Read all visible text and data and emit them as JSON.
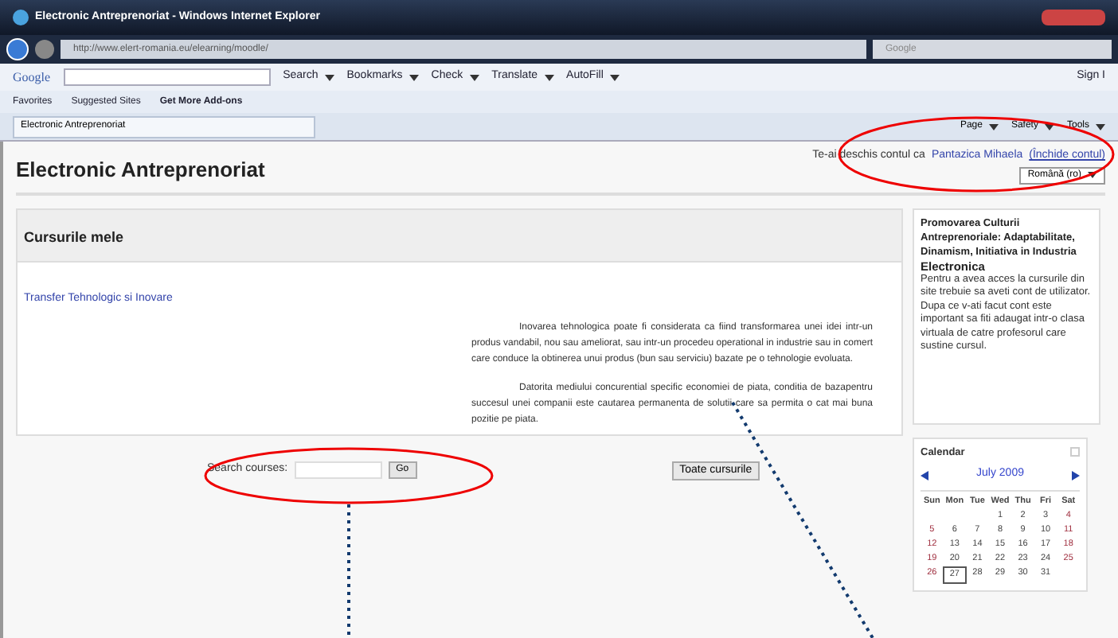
{
  "window": {
    "title": "Electronic Antreprenoriat - Windows Internet Explorer"
  },
  "address_bar": {
    "url": "http://www.elert-romania.eu/elearning/moodle/",
    "search_placeholder": "Google"
  },
  "google_toolbar": {
    "logo": "Google",
    "items": [
      "Search",
      "Bookmarks",
      "Check",
      "Translate",
      "AutoFill"
    ],
    "sign_in": "Sign I"
  },
  "favorites_bar": {
    "items": [
      "Favorites",
      "Suggested Sites",
      "Get More Add-ons"
    ]
  },
  "tab": {
    "title": "Electronic Antreprenoriat"
  },
  "command_bar": {
    "items": [
      "Page",
      "Safety",
      "Tools"
    ]
  },
  "page": {
    "title": "Electronic Antreprenoriat",
    "login_prefix": "Te-ai deschis contul ca",
    "user": "Pantazica Mihaela",
    "logout": "(Închide contul)",
    "language": "Română (ro)"
  },
  "courses": {
    "title": "Cursurile mele",
    "link": "Transfer Tehnologic si Inovare",
    "paragraphs": [
      "Inovarea tehnologica poate fi considerata ca fiind transformarea unei idei intr-un produs vandabil, nou sau ameliorat, sau intr-un procedeu operational in industrie sau in comert care conduce la obtinerea unui produs (bun sau serviciu) bazate pe o tehnologie evoluata.",
      "Datorita mediului concurential specific economiei de piata, conditia de bazapentru succesul unei companii este cautarea permanenta de solutii care sa permita o cat mai buna pozitie pe piata."
    ]
  },
  "search": {
    "label": "Search courses:",
    "button": "Go"
  },
  "all_courses_button": "Toate cursurile",
  "side_block": {
    "title": "Promovarea Culturii Antreprenoriale: Adaptabilitate, Dinamism, Initiativa in Industria",
    "subtitle": "Electronica",
    "text": "Pentru a avea acces la cursurile din site trebuie sa aveti cont de utilizator. Dupa ce v-ati facut cont este important sa fiti adaugat intr-o clasa virtuala de catre profesorul care sustine cursul."
  },
  "calendar": {
    "title": "Calendar",
    "month": "July 2009",
    "weekdays": [
      "Sun",
      "Mon",
      "Tue",
      "Wed",
      "Thu",
      "Fri",
      "Sat"
    ],
    "weeks": [
      [
        {
          "d": "1",
          "today": false
        },
        {
          "d": "2",
          "today": false
        },
        {
          "d": "3",
          "today": false
        },
        {
          "d": "4",
          "today": false
        }
      ],
      [
        {
          "d": "5",
          "today": false
        },
        {
          "d": "6",
          "today": false
        },
        {
          "d": "7",
          "today": false
        },
        {
          "d": "8",
          "today": false
        },
        {
          "d": "9",
          "today": false
        },
        {
          "d": "10",
          "today": false
        },
        {
          "d": "11",
          "today": false
        }
      ],
      [
        {
          "d": "12",
          "today": false
        },
        {
          "d": "13",
          "today": false
        },
        {
          "d": "14",
          "today": false
        },
        {
          "d": "15",
          "today": false
        },
        {
          "d": "16",
          "today": false
        },
        {
          "d": "17",
          "today": false
        },
        {
          "d": "18",
          "today": false
        }
      ],
      [
        {
          "d": "19",
          "today": false
        },
        {
          "d": "20",
          "today": false
        },
        {
          "d": "21",
          "today": false
        },
        {
          "d": "22",
          "today": false
        },
        {
          "d": "23",
          "today": false
        },
        {
          "d": "24",
          "today": false
        },
        {
          "d": "25",
          "today": false
        }
      ],
      [
        {
          "d": "26",
          "today": false
        },
        {
          "d": "27",
          "today": true
        },
        {
          "d": "28",
          "today": false
        },
        {
          "d": "29",
          "today": false
        },
        {
          "d": "30",
          "today": false
        },
        {
          "d": "31",
          "today": false
        }
      ]
    ]
  }
}
